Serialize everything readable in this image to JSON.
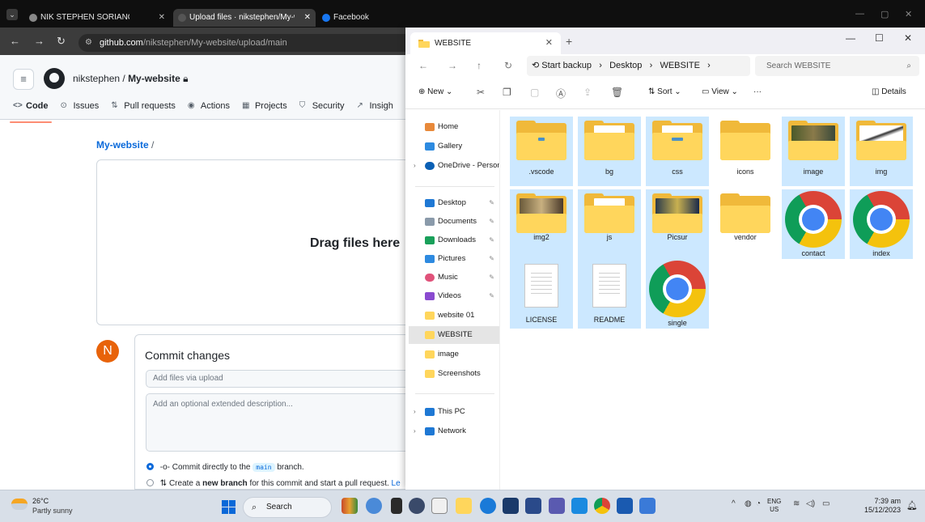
{
  "chrome": {
    "tabs": [
      {
        "title": "NIK STEPHEN SORIANO WEBSI",
        "active": false
      },
      {
        "title": "Upload files · nikstephen/My-w",
        "active": true
      },
      {
        "title": "Facebook",
        "active": false
      }
    ],
    "url_host": "github.com",
    "url_path": "/nikstephen/My-website/upload/main"
  },
  "github": {
    "owner": "nikstephen",
    "repo": "My-website",
    "nav": [
      "Code",
      "Issues",
      "Pull requests",
      "Actions",
      "Projects",
      "Security",
      "Insigh"
    ],
    "breadcrumb_repo": "My-website",
    "breadcrumb_sep": "/",
    "drag_text": "Drag files here",
    "avatar_initial": "N",
    "commit_title": "Commit changes",
    "commit_placeholder": "Add files via upload",
    "description_placeholder": "Add an optional extended description...",
    "option_direct_prefix": "Commit directly to the",
    "option_direct_branch": "main",
    "option_direct_suffix": "branch.",
    "option_new_prefix": "Create a",
    "option_new_bold": "new branch",
    "option_new_suffix": "for this commit and start a pull request.",
    "option_new_link": "Le"
  },
  "explorer": {
    "tab_title": "WEBSITE",
    "breadcrumb": [
      "Start backup",
      "Desktop",
      "WEBSITE"
    ],
    "search_placeholder": "Search WEBSITE",
    "commands": {
      "new": "New",
      "sort": "Sort",
      "view": "View",
      "more": "···",
      "details": "Details"
    },
    "sidebar": {
      "home": "Home",
      "gallery": "Gallery",
      "onedrive": "OneDrive - Persona",
      "desktop": "Desktop",
      "documents": "Documents",
      "downloads": "Downloads",
      "pictures": "Pictures",
      "music": "Music",
      "videos": "Videos",
      "website01": "website 01",
      "website": "WEBSITE",
      "image": "image",
      "screenshots": "Screenshots",
      "thispc": "This PC",
      "network": "Network"
    },
    "files": [
      ".vscode",
      "bg",
      "css",
      "icons",
      "image",
      "img",
      "img2",
      "js",
      "Picsur",
      "vendor",
      "contact",
      "index",
      "LICENSE",
      "README",
      "single"
    ]
  },
  "taskbar": {
    "temp": "26°C",
    "weather": "Partly sunny",
    "search": "Search",
    "lang_top": "ENG",
    "lang_bottom": "US",
    "time": "7:39 am",
    "date": "15/12/2023"
  }
}
